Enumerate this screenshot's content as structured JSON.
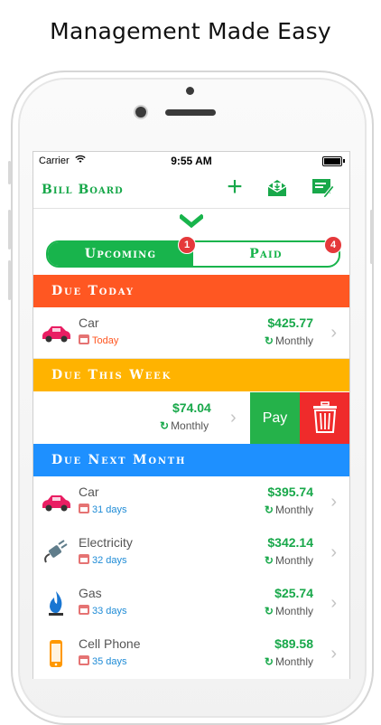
{
  "headline": "Management Made Easy",
  "status_bar": {
    "carrier": "Carrier",
    "time": "9:55 AM"
  },
  "navbar": {
    "title": "Bill Board",
    "add_icon": "plus-icon",
    "mail_icon": "mail-icon",
    "edit_icon": "edit-icon"
  },
  "segment": {
    "upcoming": "Upcoming",
    "paid": "Paid",
    "upcoming_badge": "1",
    "paid_badge": "4"
  },
  "sections": {
    "today": "Due Today",
    "week": "Due This Week",
    "month": "Due Next Month"
  },
  "today_bills": [
    {
      "name": "Car",
      "due": "Today",
      "amount": "$425.77",
      "frequency": "Monthly"
    }
  ],
  "week_swiped": {
    "amount": "$74.04",
    "frequency": "Monthly",
    "pay_label": "Pay"
  },
  "month_bills": [
    {
      "name": "Car",
      "due": "31 days",
      "amount": "$395.74",
      "frequency": "Monthly"
    },
    {
      "name": "Electricity",
      "due": "32 days",
      "amount": "$342.14",
      "frequency": "Monthly"
    },
    {
      "name": "Gas",
      "due": "33 days",
      "amount": "$25.74",
      "frequency": "Monthly"
    },
    {
      "name": "Cell Phone",
      "due": "35 days",
      "amount": "$89.58",
      "frequency": "Monthly"
    }
  ],
  "colors": {
    "green": "#18a84a",
    "orange": "#ff5722",
    "amber": "#ffb300",
    "blue": "#1e90ff",
    "red": "#ef2b2b"
  }
}
